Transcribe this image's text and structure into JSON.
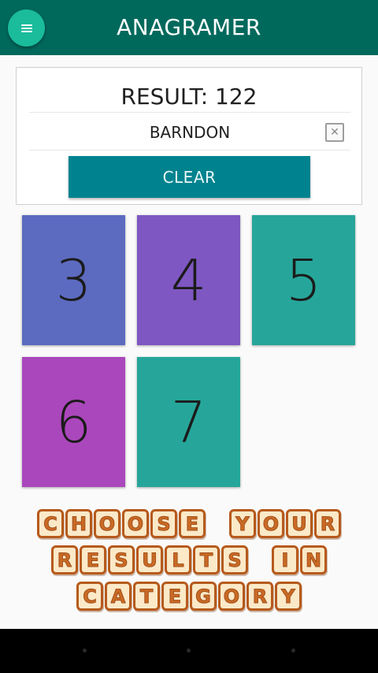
{
  "appbar": {
    "title": "ANAGRAMER",
    "menu_icon": "hamburger-menu-icon",
    "bg_color": "#00695c",
    "menu_button_color": "#1abc9c"
  },
  "result_card": {
    "result_text": "RESULT: 122",
    "input_value": "BARNDON",
    "clear_input_icon": "clear-x-icon",
    "clear_button_label": "CLEAR",
    "clear_button_color": "#00838f"
  },
  "categories": [
    {
      "label": "3",
      "color": "#5c6bc0"
    },
    {
      "label": "4",
      "color": "#7e57c2"
    },
    {
      "label": "5",
      "color": "#26a69a"
    },
    {
      "label": "6",
      "color": "#ab47bc"
    },
    {
      "label": "7",
      "color": "#26a69a"
    }
  ],
  "banner": {
    "lines": [
      "CHOOSE YOUR",
      "RESULTS IN",
      "CATEGORY"
    ]
  },
  "system_nav": {
    "icons": [
      "nav-back-icon",
      "nav-home-icon",
      "nav-recents-icon"
    ]
  }
}
